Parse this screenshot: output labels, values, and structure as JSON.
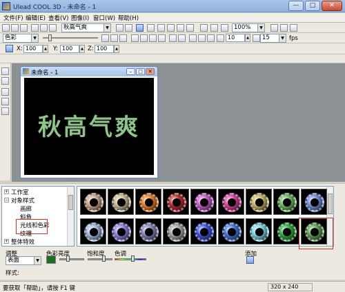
{
  "window": {
    "title": "Ulead COOL 3D - 未命名 - 1",
    "min_label": "—",
    "max_label": "□",
    "close_label": "✕"
  },
  "menu": [
    "文件(F)",
    "编辑(E)",
    "查看(V)",
    "图像(I)",
    "窗口(W)",
    "帮助(H)"
  ],
  "toolbar1": {
    "font_combo": "秋高气爽",
    "zoom_combo": "100%",
    "fps_value": "15",
    "fps_label": "fps"
  },
  "toolbar2": {
    "color_combo": "色彩",
    "frame_value": "10"
  },
  "toolbar3": {
    "x_label": "X:",
    "x_value": "100",
    "y_label": "Y:",
    "y_value": "100",
    "z_label": "Z:",
    "z_value": "100"
  },
  "document": {
    "title": "未命名 - 1",
    "canvas_text": "秋高气爽",
    "text_color": "#8ec38a",
    "background_color": "#000000"
  },
  "tree": {
    "items": [
      {
        "label": "工作室",
        "expander": "+"
      },
      {
        "label": "对象样式",
        "expander": "−"
      },
      {
        "label": "画廊"
      },
      {
        "label": "斜角"
      },
      {
        "label": "光线和色彩",
        "selected": true
      },
      {
        "label": "纹理"
      },
      {
        "label": "整体特效",
        "expander": "+"
      }
    ]
  },
  "thumbnails": {
    "gear_colors": [
      "#c9a48a",
      "#c7b690",
      "#e07a28",
      "#b0262a",
      "#c458c9",
      "#d03f9c",
      "#c8b060",
      "#69b35a",
      "#6a8ad8",
      "#9db6d8",
      "#8a78d8",
      "#7e7fb2",
      "#a39ea0",
      "#3a4fd8",
      "#3f72d0",
      "#79cfe0",
      "#2ea33a",
      "#5e9a52"
    ],
    "selected_index": 17
  },
  "attributes": {
    "adjust_label": "调整",
    "surface_combo": "表面",
    "color_label": "色彩",
    "brightness_label": "亮度",
    "gloss_label": "饱和度",
    "hue_label": "色调",
    "add_label": "添加",
    "style_label": "样式:",
    "swatch_color": "#1e6b2a"
  },
  "status": {
    "hint": "要获取「帮助」，请按 F1 键",
    "resolution": "320 x 240"
  }
}
